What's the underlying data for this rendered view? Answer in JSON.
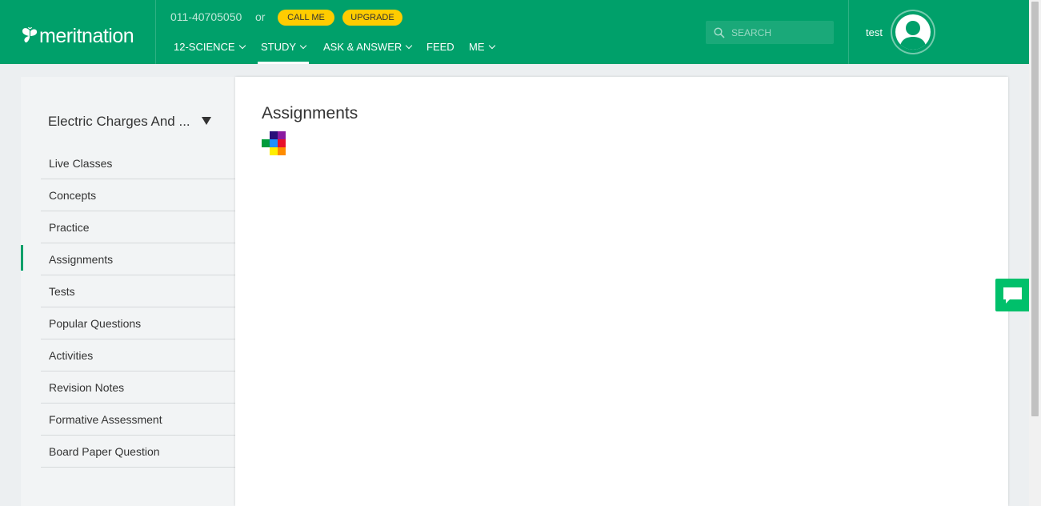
{
  "header": {
    "logo_text": "meritnation",
    "phone": "011-40705050",
    "or_text": "or",
    "call_me_label": "CALL ME",
    "upgrade_label": "UPGRADE",
    "nav": [
      {
        "label": "12-SCIENCE",
        "has_dropdown": true
      },
      {
        "label": "STUDY",
        "has_dropdown": true,
        "active": true
      },
      {
        "label": "ASK & ANSWER",
        "has_dropdown": true
      },
      {
        "label": "FEED",
        "has_dropdown": false
      },
      {
        "label": "ME",
        "has_dropdown": true
      }
    ],
    "search": {
      "placeholder": "SEARCH",
      "icon": "search-icon"
    },
    "username": "test",
    "avatar_icon": "user-avatar-icon"
  },
  "sidebar": {
    "chapter_title": "Electric Charges And ...",
    "items": [
      {
        "label": "Live Classes"
      },
      {
        "label": "Concepts"
      },
      {
        "label": "Practice"
      },
      {
        "label": "Assignments",
        "active": true
      },
      {
        "label": "Tests"
      },
      {
        "label": "Popular Questions"
      },
      {
        "label": "Activities"
      },
      {
        "label": "Revision Notes"
      },
      {
        "label": "Formative Assessment"
      },
      {
        "label": "Board Paper Question"
      }
    ]
  },
  "main": {
    "title": "Assignments",
    "loader_colors": [
      "#2a0f7a",
      "#8a1aa0",
      "#009b3a",
      "#1e90ff",
      "#e8102a",
      "#ffee00",
      "#ff8c00"
    ]
  },
  "chat_icon": "chat-bubble-icon",
  "colors": {
    "brand": "#00a06a",
    "accent": "#ffcc00",
    "chat": "#00c06b"
  }
}
